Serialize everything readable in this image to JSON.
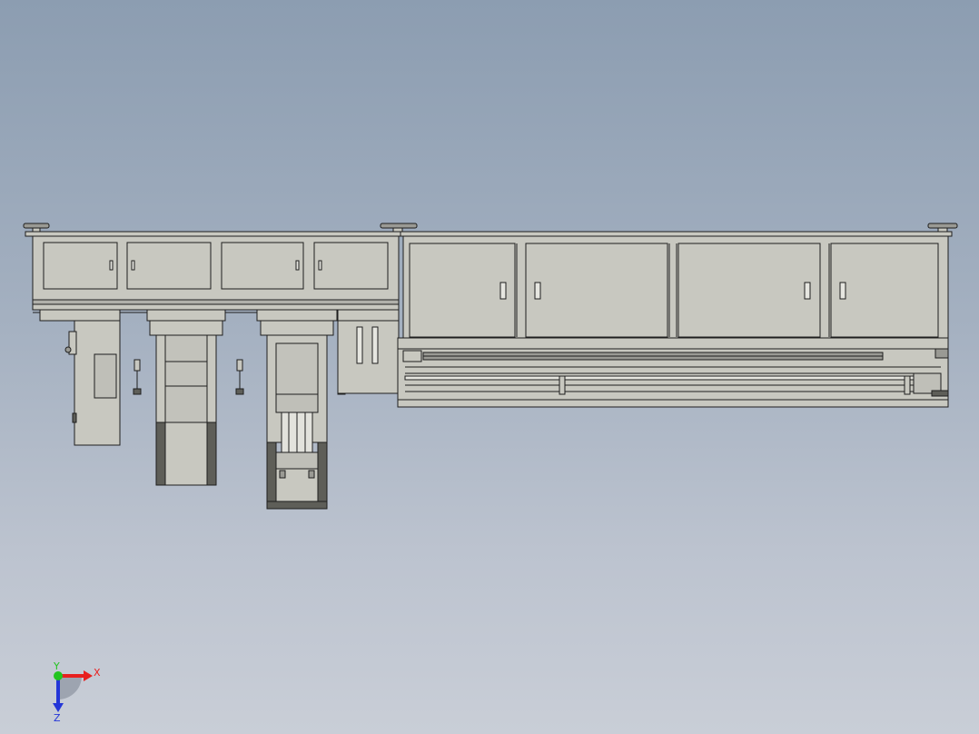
{
  "viewport": {
    "background_top": "#8c9db1",
    "background_bottom": "#c9ced7",
    "body_color": "#c8c8c0",
    "edge_color": "#1e1e1e",
    "dark_panel_color": "#5e5e58"
  },
  "model": {
    "left_unit_doors": 4,
    "right_unit_doors": 4,
    "leveling_feet": 3
  },
  "triad": {
    "x_label": "X",
    "y_label": "Y",
    "z_label": "Z",
    "x_color": "#e8201f",
    "y_color": "#22c41f",
    "z_color": "#2436d8"
  }
}
